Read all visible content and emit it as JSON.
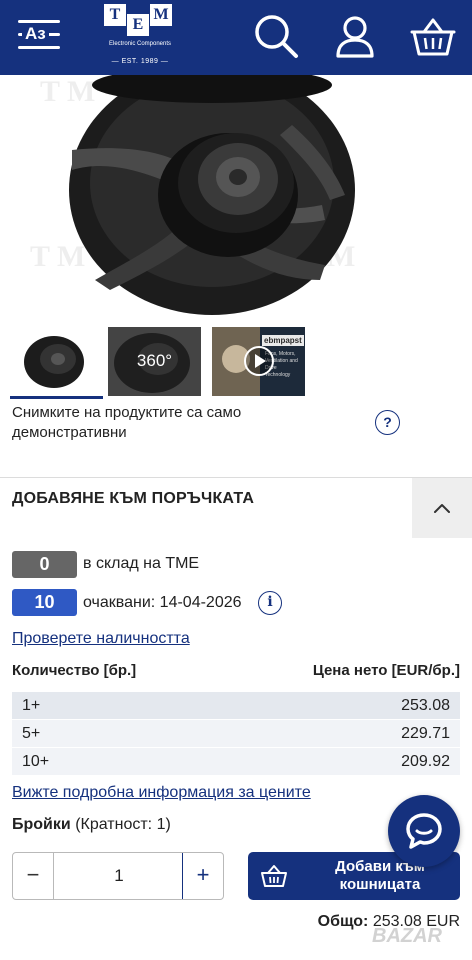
{
  "header": {
    "lang_label": "Аз",
    "logo": {
      "letters": [
        "T",
        "M",
        "E"
      ],
      "subtitle": "Electronic Components",
      "est": "— EST. 1989 —"
    },
    "icons": {
      "menu": "hamburger-icon",
      "search": "search-icon",
      "account": "user-icon",
      "cart": "basket-icon"
    }
  },
  "gallery": {
    "thumbnails": [
      {
        "type": "image",
        "name": "product-photo"
      },
      {
        "type": "360",
        "label": "360°"
      },
      {
        "type": "video",
        "brand": "ebmpapst",
        "desc": "Fans, Motors, Ventilation and Drive Technology"
      }
    ],
    "disclaimer": "Снимките на продуктите са само демонстративни",
    "help": "?"
  },
  "order": {
    "title": "ДОБАВЯНЕ КЪМ ПОРЪЧКАТА",
    "stock": {
      "value": "0",
      "label": "в склад на TME"
    },
    "expected": {
      "value": "10",
      "label": "очаквани: 14-04-2026"
    },
    "info_icon": "i",
    "check_link": "Проверете наличността",
    "columns": {
      "quantity": "Количество [бр.]",
      "price": "Цена нето [EUR/бр.]"
    },
    "prices": [
      {
        "qty": "1+",
        "price": "253.08"
      },
      {
        "qty": "5+",
        "price": "229.71"
      },
      {
        "qty": "10+",
        "price": "209.92"
      }
    ],
    "prices_link": "Вижте подробна информация за цените",
    "units": {
      "label": "Бройки",
      "multiplicity": "(Кратност: 1)"
    },
    "quantity_value": "1",
    "minus": "−",
    "plus": "+",
    "add_to_cart": "Добави към кошницата",
    "total_label": "Общо:",
    "total_value": "253.08 EUR"
  },
  "watermark": "BAZAR"
}
